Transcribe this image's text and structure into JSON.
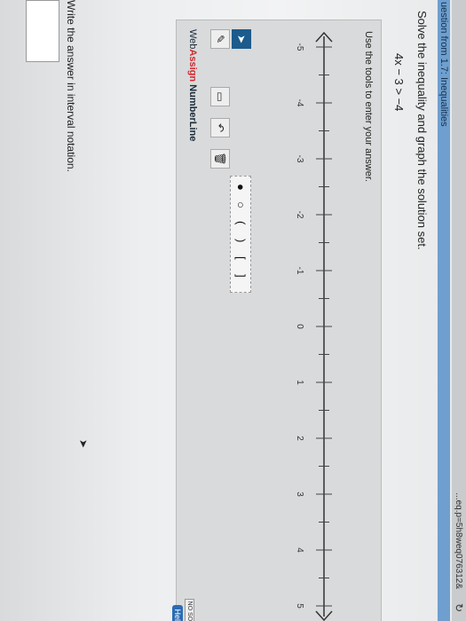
{
  "url": {
    "text": "...eq.p=5h8weq076312&",
    "reload_icon": "reload-icon"
  },
  "question": {
    "header": "uestion from 1.7: Inequalities",
    "prompt": "Solve the inequality and graph the solution set.",
    "inequality": "4x − 3 > −4"
  },
  "tool": {
    "instructions": "Use the tools to enter your answer.",
    "number_line": {
      "min": -5,
      "max": 5,
      "labels": [
        "-5",
        "-4",
        "-3",
        "-2",
        "-1",
        "0",
        "1",
        "2",
        "3",
        "4",
        "5"
      ]
    },
    "buttons": {
      "pointer": "arrow-pointer-icon",
      "pencil": "pencil-icon",
      "eraser": "eraser-icon",
      "undo": "undo-icon",
      "trash": "trash-icon"
    },
    "symbols": [
      "●",
      "○",
      "(",
      ")",
      "[",
      "]"
    ],
    "brand": {
      "web": "Web",
      "assign": "Assign",
      "product": "NumberLine"
    },
    "no_solution": "NO SOL",
    "help": "Help"
  },
  "answer": {
    "instruction": "Write the answer in interval notation.",
    "value": ""
  },
  "colors": {
    "accent": "#6e9fcf",
    "brand_red": "#d0282d",
    "active_tool": "#1c5b8c"
  }
}
